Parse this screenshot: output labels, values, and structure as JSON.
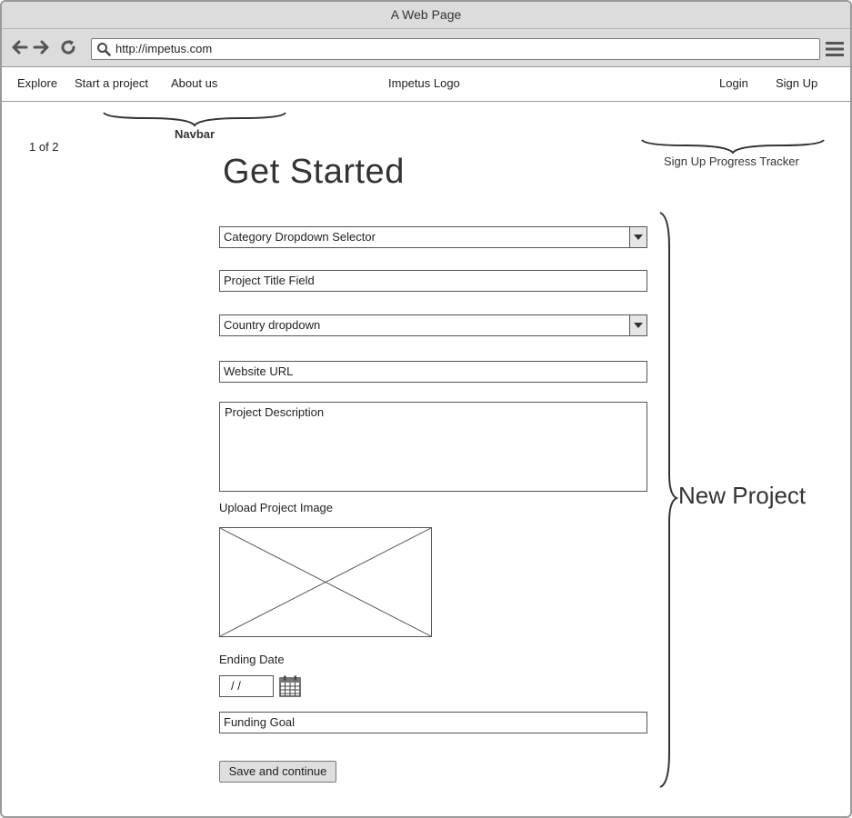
{
  "browser": {
    "title": "A Web Page",
    "url": "http://impetus.com"
  },
  "site_nav": {
    "explore": "Explore",
    "start_project": "Start a project",
    "about": "About us",
    "logo": "Impetus Logo",
    "login": "Login",
    "signup": "Sign Up"
  },
  "annotations": {
    "navbar": "Navbar",
    "tracker": "Sign Up Progress Tracker",
    "new_project": "New Project"
  },
  "progress": "1 of 2",
  "heading": "Get Started",
  "form": {
    "category": "Category Dropdown Selector",
    "project_title": "Project Title Field",
    "country": "Country dropdown",
    "website": "Website URL",
    "description": "Project Description",
    "upload_label": "Upload Project Image",
    "ending_date_label": "Ending Date",
    "date_value": "/ /",
    "funding_goal": "Funding Goal",
    "submit": "Save and continue"
  },
  "icons": {
    "back": "arrow-left-icon",
    "forward": "arrow-right-icon",
    "reload": "reload-icon",
    "search": "search-icon",
    "menu": "hamburger-menu-icon",
    "calendar": "calendar-icon"
  }
}
